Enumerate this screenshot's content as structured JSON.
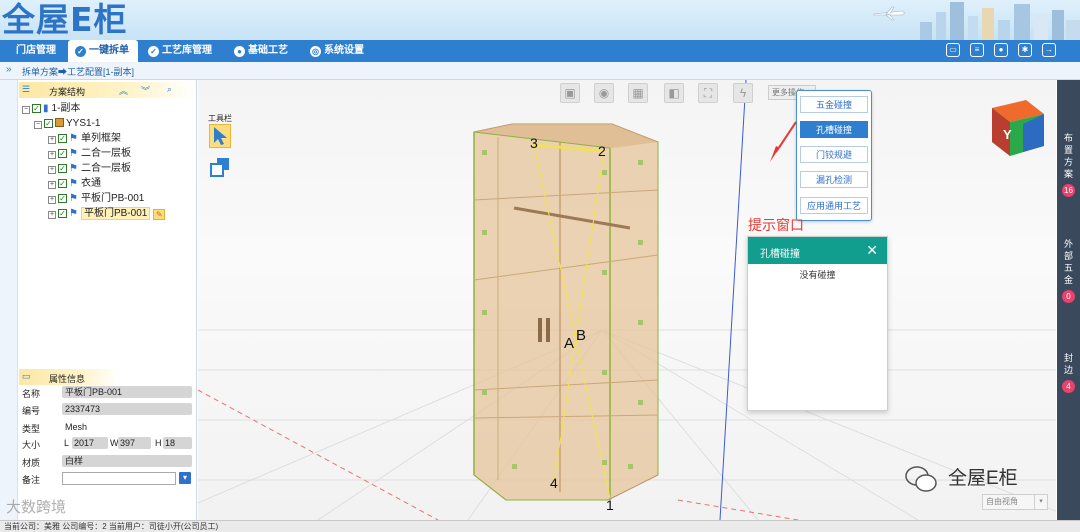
{
  "app": {
    "logo": "全屋E柜"
  },
  "nav": [
    {
      "label": "门店管理",
      "active": false
    },
    {
      "label": "一键拆单",
      "active": true
    },
    {
      "label": "工艺库管理",
      "active": false
    },
    {
      "label": "基础工艺",
      "active": false
    },
    {
      "label": "系统设置",
      "active": false
    }
  ],
  "top_tools": [
    "monitor-icon",
    "document-icon",
    "user-icon",
    "gear-icon",
    "exit-icon"
  ],
  "breadcrumb": "拆单方案➡工艺配置[1-副本]",
  "tree_panel": {
    "title": "方案结构",
    "nodes": [
      {
        "label": "1-副本",
        "level": 0
      },
      {
        "label": "YYS1-1",
        "level": 1
      },
      {
        "label": "单列框架",
        "level": 2
      },
      {
        "label": "二合一层板",
        "level": 2
      },
      {
        "label": "二合一层板",
        "level": 2
      },
      {
        "label": "衣通",
        "level": 2
      },
      {
        "label": "平板门PB-001",
        "level": 2
      },
      {
        "label": "平板门PB-001",
        "level": 2,
        "selected": true
      }
    ]
  },
  "props_panel": {
    "title": "属性信息",
    "name_label": "名称",
    "name_value": "平板门PB-001",
    "code_label": "编号",
    "code_value": "2337473",
    "type_label": "类型",
    "type_value": "Mesh",
    "size_label": "大小",
    "l_label": "L",
    "l_value": "2017",
    "w_label": "W",
    "w_value": "397",
    "h_label": "H",
    "h_value": "18",
    "material_label": "材质",
    "material_value": "白样",
    "note_label": "备注",
    "note_value": ""
  },
  "viewport": {
    "toolbar_label": "工具栏",
    "more_label": "更多操作",
    "view_cube_label": "Y",
    "points": {
      "p1": "1",
      "p2": "2",
      "p3": "3",
      "p4": "4",
      "a": "A",
      "b": "B"
    },
    "dropdown": [
      {
        "label": "五金碰撞",
        "active": false
      },
      {
        "label": "孔槽碰撞",
        "active": true
      },
      {
        "label": "门铰规避",
        "active": false
      },
      {
        "label": "漏孔检测",
        "active": false
      },
      {
        "label": "应用通用工艺",
        "active": false
      }
    ],
    "hint_label": "提示窗口",
    "popup": {
      "title": "孔槽碰撞",
      "body": "没有碰撞"
    },
    "view_select": "自由视角",
    "watermark": "全屋E柜"
  },
  "rail": [
    {
      "label": "布置方案",
      "count": "16"
    },
    {
      "label": "外部五金",
      "count": "0"
    },
    {
      "label": "封边",
      "count": "4"
    }
  ],
  "status": {
    "text": "当前公司：美雅   公司编号：2   当前用户：司徒小开(公司员工)",
    "watermark": "大数跨境"
  },
  "colors": {
    "nav": "#2e7fd0",
    "popup_header": "#129e8e",
    "badge": "#e8436a",
    "hint": "#e53935"
  }
}
